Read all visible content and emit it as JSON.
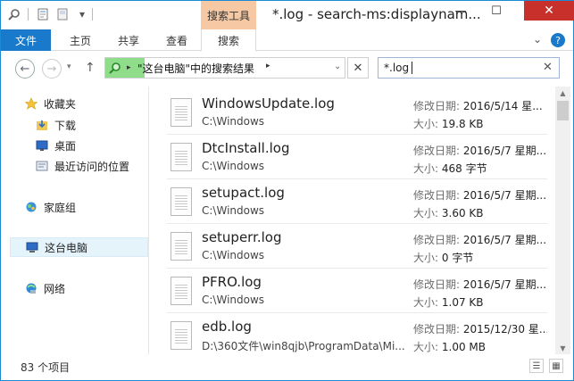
{
  "titlebar": {
    "context_tab": "搜索工具",
    "title": "*.log - search-ms:displaynam...",
    "minimize": "—",
    "maximize": "☐",
    "close": "✕"
  },
  "ribbon": {
    "tabs": [
      {
        "label": "文件"
      },
      {
        "label": "主页"
      },
      {
        "label": "共享"
      },
      {
        "label": "查看"
      },
      {
        "label": "搜索"
      }
    ],
    "collapse_glyph": "⌄",
    "help_glyph": "?"
  },
  "address": {
    "breadcrumb": "\"这台电脑\"中的搜索结果",
    "sep_glyph": "▸",
    "dropdown_glyph": "⌄",
    "clear_glyph": "✕"
  },
  "search": {
    "value": "*.log",
    "clear_glyph": "✕"
  },
  "sidebar": {
    "items": [
      {
        "label": "收藏夹",
        "icon": "star-icon"
      },
      {
        "label": "下载",
        "icon": "download-folder-icon"
      },
      {
        "label": "桌面",
        "icon": "desktop-icon"
      },
      {
        "label": "最近访问的位置",
        "icon": "recent-places-icon"
      },
      {
        "label": "家庭组",
        "icon": "homegroup-icon"
      },
      {
        "label": "这台电脑",
        "icon": "this-pc-icon"
      },
      {
        "label": "网络",
        "icon": "network-icon"
      }
    ]
  },
  "columns": {
    "date_label": "修改日期:",
    "size_label": "大小:"
  },
  "files": [
    {
      "name": "WindowsUpdate.log",
      "path": "C:\\Windows",
      "date": "2016/5/14 星...",
      "size": "19.8 KB"
    },
    {
      "name": "DtcInstall.log",
      "path": "C:\\Windows",
      "date": "2016/5/7 星期...",
      "size": "468 字节"
    },
    {
      "name": "setupact.log",
      "path": "C:\\Windows",
      "date": "2016/5/7 星期...",
      "size": "3.60 KB"
    },
    {
      "name": "setuperr.log",
      "path": "C:\\Windows",
      "date": "2016/5/7 星期...",
      "size": "0 字节"
    },
    {
      "name": "PFRO.log",
      "path": "C:\\Windows",
      "date": "2016/5/7 星期...",
      "size": "1.07 KB"
    },
    {
      "name": "edb.log",
      "path": "D:\\360文件\\win8qjb\\ProgramData\\Mi...",
      "date": "2015/12/30 星...",
      "size": "1.00 MB"
    }
  ],
  "status": {
    "count": "83 个项目"
  }
}
